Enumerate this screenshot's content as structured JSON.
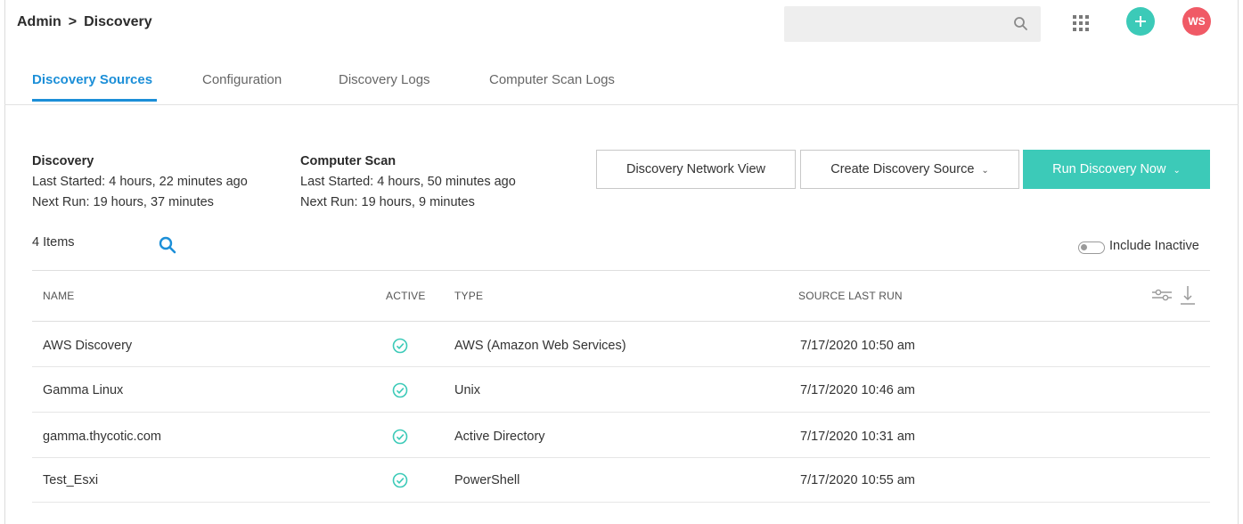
{
  "header": {
    "breadcrumb": [
      "Admin",
      ">",
      "Discovery"
    ],
    "search_value": "",
    "avatar_initials": "WS"
  },
  "tabs": [
    {
      "label": "Discovery Sources",
      "active": true
    },
    {
      "label": "Configuration",
      "active": false
    },
    {
      "label": "Discovery Logs",
      "active": false
    },
    {
      "label": "Computer Scan Logs",
      "active": false
    }
  ],
  "discovery_info": {
    "title": "Discovery",
    "last_started": "Last Started: 4 hours, 22 minutes ago",
    "next_run": "Next Run: 19 hours, 37 minutes"
  },
  "computer_scan_info": {
    "title": "Computer Scan",
    "last_started": "Last Started: 4 hours, 50 minutes ago",
    "next_run": "Next Run: 19 hours, 9 minutes"
  },
  "actions": {
    "network_view": "Discovery Network View",
    "create_source": "Create Discovery Source",
    "run_now": "Run Discovery Now"
  },
  "list": {
    "items_count": "4 Items",
    "include_inactive_label": "Include Inactive",
    "include_inactive": false
  },
  "table": {
    "headers": {
      "name": "NAME",
      "active": "ACTIVE",
      "type": "TYPE",
      "last_run": "SOURCE LAST RUN"
    },
    "rows": [
      {
        "name": "AWS Discovery",
        "active": true,
        "type": "AWS (Amazon Web Services)",
        "last_run": "7/17/2020 10:50 am"
      },
      {
        "name": "Gamma Linux",
        "active": true,
        "type": "Unix",
        "last_run": "7/17/2020 10:46 am"
      },
      {
        "name": "gamma.thycotic.com",
        "active": true,
        "type": "Active Directory",
        "last_run": "7/17/2020 10:31 am"
      },
      {
        "name": "Test_Esxi",
        "active": true,
        "type": "PowerShell",
        "last_run": "7/17/2020 10:55 am"
      }
    ]
  },
  "colors": {
    "accent_blue": "#1c8fd8",
    "teal": "#3ccab8",
    "avatar_red": "#f05a66"
  },
  "icons": [
    "search-icon",
    "apps-grid-icon",
    "plus-icon",
    "check-circle-icon",
    "toggle-icon",
    "column-settings-icon",
    "download-icon",
    "chevron-down-icon"
  ]
}
